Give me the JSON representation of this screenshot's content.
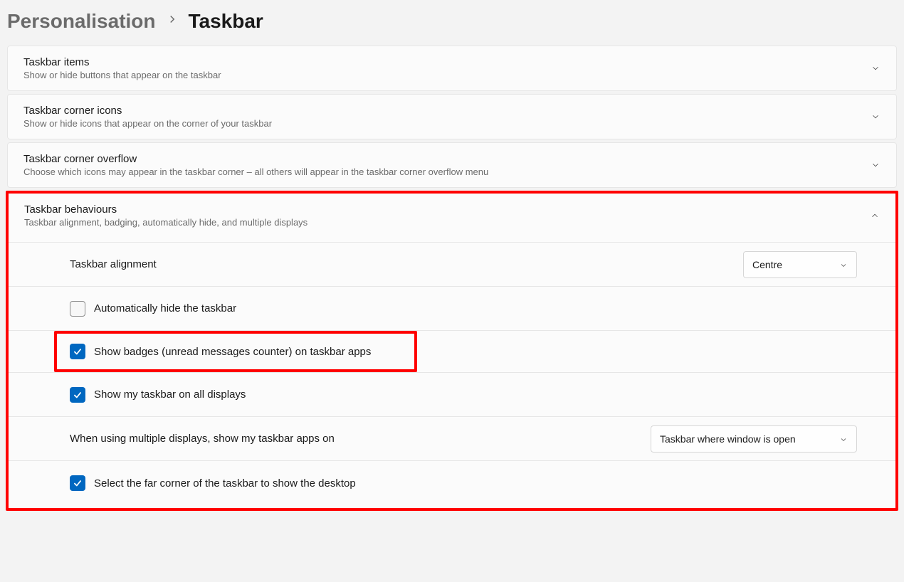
{
  "breadcrumb": {
    "parent": "Personalisation",
    "current": "Taskbar"
  },
  "sections": {
    "items": {
      "title": "Taskbar items",
      "subtitle": "Show or hide buttons that appear on the taskbar"
    },
    "corner_icons": {
      "title": "Taskbar corner icons",
      "subtitle": "Show or hide icons that appear on the corner of your taskbar"
    },
    "corner_overflow": {
      "title": "Taskbar corner overflow",
      "subtitle": "Choose which icons may appear in the taskbar corner – all others will appear in the taskbar corner overflow menu"
    },
    "behaviours": {
      "title": "Taskbar behaviours",
      "subtitle": "Taskbar alignment, badging, automatically hide, and multiple displays",
      "alignment_label": "Taskbar alignment",
      "alignment_value": "Centre",
      "auto_hide_label": "Automatically hide the taskbar",
      "badges_label": "Show badges (unread messages counter) on taskbar apps",
      "all_displays_label": "Show my taskbar on all displays",
      "multi_displays_label": "When using multiple displays, show my taskbar apps on",
      "multi_displays_value": "Taskbar where window is open",
      "far_corner_label": "Select the far corner of the taskbar to show the desktop"
    }
  }
}
